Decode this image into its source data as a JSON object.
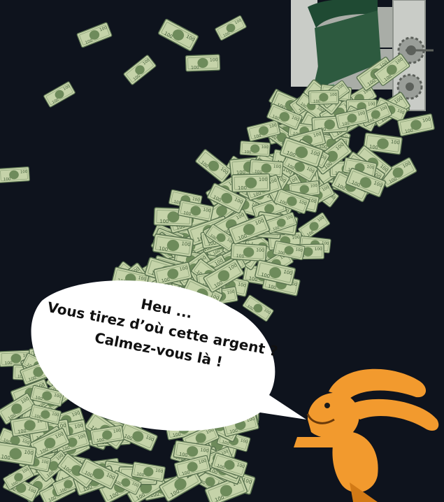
{
  "speech": {
    "line1": "Heu ...",
    "line2": "Vous tirez d’où cette argent ?",
    "line3": "Calmez-vous là !"
  },
  "banknote": {
    "denomination": "100"
  },
  "colors": {
    "background": "#0e131d",
    "note_fill": "#c5d3a9",
    "note_portrait": "#6e8b5b",
    "note_border": "#5a7350",
    "machine_body": "#c9ccc7",
    "machine_shadow": "#8f948e",
    "printed_sheet": "#2d5a3f",
    "rabbit": "#f29a2e",
    "rabbit_dark": "#d27a16",
    "bubble": "#ffffff"
  }
}
